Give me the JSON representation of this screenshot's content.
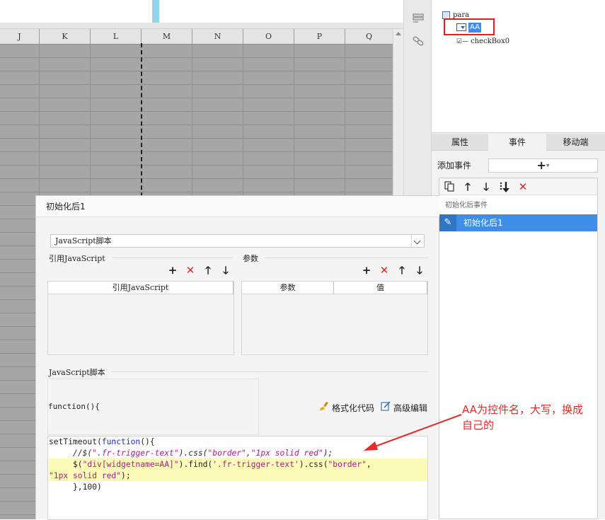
{
  "sheet": {
    "columns": [
      "J",
      "K",
      "L",
      "M",
      "N",
      "O",
      "P",
      "Q"
    ]
  },
  "tree": {
    "root": "para",
    "selected": "AA",
    "child2": "checkBox0"
  },
  "right_tabs": [
    "属性",
    "事件",
    "移动端"
  ],
  "events": {
    "add_label": "添加事件",
    "add_button": "+",
    "group_label": "初始化后事件",
    "selected_event": "初始化后1"
  },
  "dialog": {
    "title": "初始化后1",
    "script_type": "JavaScript脚本",
    "ref_section": "引用JavaScript",
    "params_section": "参数",
    "ref_table_header": "引用JavaScript",
    "params_headers": [
      "参数",
      "值"
    ],
    "script_section": "JavaScript脚本",
    "func_header": "function(){",
    "format_code": "格式化代码",
    "advanced_edit": "高级编辑",
    "code_lines": [
      "setTimeout(function(){",
      "     //$(\".fr-trigger-text\").css(\"border\",\"1px solid red\");",
      "     $(\"div[widgetname=AA]\").find('.fr-trigger-text').css(\"border\",",
      "\"1px solid red\");",
      "     },100)"
    ]
  },
  "annotation": {
    "line1": "AA为控件名，大写，换成",
    "line2": "自己的",
    "color": "#e32b2b"
  }
}
